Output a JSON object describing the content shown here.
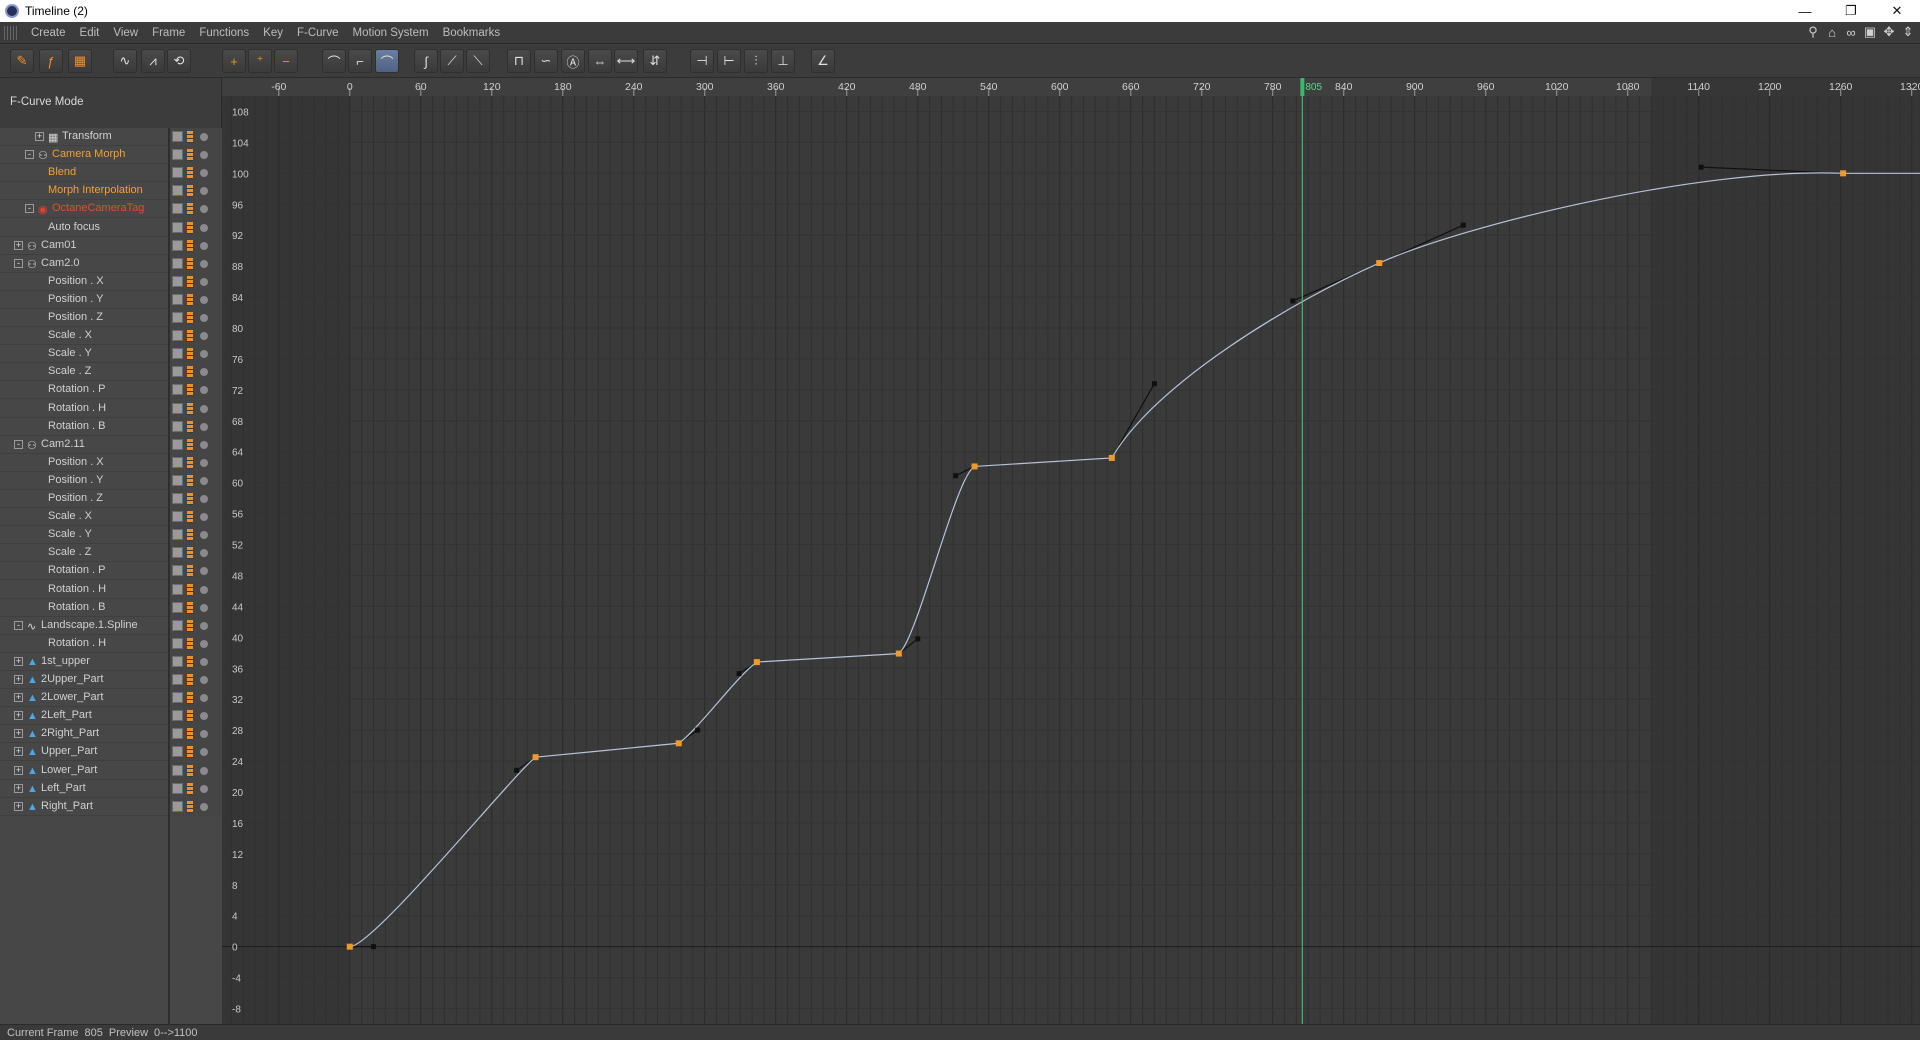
{
  "window": {
    "title": "Timeline (2)"
  },
  "menu": [
    "Create",
    "Edit",
    "View",
    "Frame",
    "Functions",
    "Key",
    "F-Curve",
    "Motion System",
    "Bookmarks"
  ],
  "toolbar_icons": [
    "key-mode-icon",
    "fcurve-mode-icon",
    "dope-sheet-icon",
    "show-curves-icon",
    "snap-curve-icon",
    "loop-icon",
    "add-key-icon",
    "add-key-multi-icon",
    "delete-key-icon",
    "tangent-zero-icon",
    "tangent-flat-icon",
    "tangent-active-icon",
    "spline-linear-icon",
    "spline-ease-in-icon",
    "spline-ease-out-icon",
    "interp-step-icon",
    "interp-curve-icon",
    "interp-auto-icon",
    "clamp-icon",
    "lock-time-icon",
    "lock-value-icon",
    "lock-tangent-icon",
    "lock-length-icon",
    "break-tangent-icon",
    "zero-angle-icon",
    "zero-length-icon"
  ],
  "sidebar": {
    "mode_label": "F-Curve Mode",
    "rows": [
      {
        "label": "Transform",
        "indent": 2,
        "toggle": "+",
        "icon": "checker-icon",
        "color": "normal"
      },
      {
        "label": "Camera Morph",
        "indent": 1,
        "toggle": "−",
        "icon": "camera-morph-icon",
        "color": "orange"
      },
      {
        "label": "Blend",
        "indent": 3,
        "toggle": "",
        "icon": "",
        "color": "orange"
      },
      {
        "label": "Morph Interpolation",
        "indent": 3,
        "toggle": "",
        "icon": "",
        "color": "orange"
      },
      {
        "label": "OctaneCameraTag",
        "indent": 1,
        "toggle": "−",
        "icon": "octane-tag-icon",
        "color": "red"
      },
      {
        "label": "Auto focus",
        "indent": 3,
        "toggle": "",
        "icon": "",
        "color": "normal"
      },
      {
        "label": "Cam01",
        "indent": 0,
        "toggle": "+",
        "icon": "camera-icon",
        "color": "normal"
      },
      {
        "label": "Cam2.0",
        "indent": 0,
        "toggle": "−",
        "icon": "camera-icon",
        "color": "normal"
      },
      {
        "label": "Position . X",
        "indent": 3,
        "toggle": "",
        "icon": "",
        "color": "normal"
      },
      {
        "label": "Position . Y",
        "indent": 3,
        "toggle": "",
        "icon": "",
        "color": "normal"
      },
      {
        "label": "Position . Z",
        "indent": 3,
        "toggle": "",
        "icon": "",
        "color": "normal"
      },
      {
        "label": "Scale . X",
        "indent": 3,
        "toggle": "",
        "icon": "",
        "color": "normal"
      },
      {
        "label": "Scale . Y",
        "indent": 3,
        "toggle": "",
        "icon": "",
        "color": "normal"
      },
      {
        "label": "Scale . Z",
        "indent": 3,
        "toggle": "",
        "icon": "",
        "color": "normal"
      },
      {
        "label": "Rotation . P",
        "indent": 3,
        "toggle": "",
        "icon": "",
        "color": "normal"
      },
      {
        "label": "Rotation . H",
        "indent": 3,
        "toggle": "",
        "icon": "",
        "color": "normal"
      },
      {
        "label": "Rotation . B",
        "indent": 3,
        "toggle": "",
        "icon": "",
        "color": "normal"
      },
      {
        "label": "Cam2.11",
        "indent": 0,
        "toggle": "−",
        "icon": "camera-icon",
        "color": "normal"
      },
      {
        "label": "Position . X",
        "indent": 3,
        "toggle": "",
        "icon": "",
        "color": "normal"
      },
      {
        "label": "Position . Y",
        "indent": 3,
        "toggle": "",
        "icon": "",
        "color": "normal"
      },
      {
        "label": "Position . Z",
        "indent": 3,
        "toggle": "",
        "icon": "",
        "color": "normal"
      },
      {
        "label": "Scale . X",
        "indent": 3,
        "toggle": "",
        "icon": "",
        "color": "normal"
      },
      {
        "label": "Scale . Y",
        "indent": 3,
        "toggle": "",
        "icon": "",
        "color": "normal"
      },
      {
        "label": "Scale . Z",
        "indent": 3,
        "toggle": "",
        "icon": "",
        "color": "normal"
      },
      {
        "label": "Rotation . P",
        "indent": 3,
        "toggle": "",
        "icon": "",
        "color": "normal"
      },
      {
        "label": "Rotation . H",
        "indent": 3,
        "toggle": "",
        "icon": "",
        "color": "normal"
      },
      {
        "label": "Rotation . B",
        "indent": 3,
        "toggle": "",
        "icon": "",
        "color": "normal"
      },
      {
        "label": "Landscape.1.Spline",
        "indent": 0,
        "toggle": "−",
        "icon": "spline-icon",
        "color": "normal"
      },
      {
        "label": "Rotation . H",
        "indent": 3,
        "toggle": "",
        "icon": "",
        "color": "normal"
      },
      {
        "label": "1st_upper",
        "indent": 0,
        "toggle": "+",
        "icon": "object-icon",
        "color": "normal"
      },
      {
        "label": "2Upper_Part",
        "indent": 0,
        "toggle": "+",
        "icon": "object-icon",
        "color": "normal"
      },
      {
        "label": "2Lower_Part",
        "indent": 0,
        "toggle": "+",
        "icon": "object-icon",
        "color": "normal"
      },
      {
        "label": "2Left_Part",
        "indent": 0,
        "toggle": "+",
        "icon": "object-icon",
        "color": "normal"
      },
      {
        "label": "2Right_Part",
        "indent": 0,
        "toggle": "+",
        "icon": "object-icon",
        "color": "normal"
      },
      {
        "label": "Upper_Part",
        "indent": 0,
        "toggle": "+",
        "icon": "object-icon",
        "color": "normal"
      },
      {
        "label": "Lower_Part",
        "indent": 0,
        "toggle": "+",
        "icon": "object-icon",
        "color": "normal"
      },
      {
        "label": "Left_Part",
        "indent": 0,
        "toggle": "+",
        "icon": "object-icon",
        "color": "normal"
      },
      {
        "label": "Right_Part",
        "indent": 0,
        "toggle": "+",
        "icon": "object-icon",
        "color": "normal"
      }
    ]
  },
  "ruler": {
    "ticks": [
      "-60",
      "0",
      "60",
      "120",
      "180",
      "240",
      "300",
      "360",
      "420",
      "480",
      "540",
      "600",
      "660",
      "720",
      "780",
      "840",
      "900",
      "960",
      "1020",
      "1080",
      "1140",
      "1200",
      "1260",
      "1320"
    ],
    "tick_values": [
      -60,
      0,
      60,
      120,
      180,
      240,
      300,
      360,
      420,
      480,
      540,
      600,
      660,
      720,
      780,
      840,
      900,
      960,
      1020,
      1080,
      1140,
      1200,
      1260,
      1320
    ],
    "current_frame_label": "805"
  },
  "chart_data": {
    "type": "line",
    "x_range": [
      -108,
      1327
    ],
    "y_range": [
      -10,
      110
    ],
    "y_ticks": [
      "108",
      "104",
      "100",
      "96",
      "92",
      "88",
      "84",
      "80",
      "76",
      "72",
      "68",
      "64",
      "60",
      "56",
      "52",
      "48",
      "44",
      "40",
      "36",
      "32",
      "28",
      "24",
      "20",
      "16",
      "12",
      "8",
      "4",
      "0",
      "-4",
      "-8"
    ],
    "y_tick_values": [
      108,
      104,
      100,
      96,
      92,
      88,
      84,
      80,
      76,
      72,
      68,
      64,
      60,
      56,
      52,
      48,
      44,
      40,
      36,
      32,
      28,
      24,
      20,
      16,
      12,
      8,
      4,
      0,
      -4,
      -8
    ],
    "preview_range": [
      0,
      1100
    ],
    "current_frame": 805,
    "keys": [
      {
        "x": 0,
        "y": 0
      },
      {
        "x": 157,
        "y": 24.5
      },
      {
        "x": 278,
        "y": 26.3
      },
      {
        "x": 344,
        "y": 36.8
      },
      {
        "x": 464,
        "y": 37.9
      },
      {
        "x": 528,
        "y": 62.1
      },
      {
        "x": 644,
        "y": 63.2
      },
      {
        "x": 870,
        "y": 88.4
      },
      {
        "x": 1262,
        "y": 100
      }
    ],
    "tangent_handles": [
      {
        "x": 20,
        "y": 0
      },
      {
        "x": 141,
        "y": 22.8
      },
      {
        "x": 294,
        "y": 28
      },
      {
        "x": 329,
        "y": 35.3
      },
      {
        "x": 480,
        "y": 39.8
      },
      {
        "x": 512,
        "y": 60.9
      },
      {
        "x": 680,
        "y": 72.8
      },
      {
        "x": 797,
        "y": 83.5
      },
      {
        "x": 941,
        "y": 93.3
      },
      {
        "x": 1142,
        "y": 100.8
      }
    ],
    "colors": {
      "curve": "#b8c2d8",
      "key": "#f09a28",
      "handle": "#101010",
      "playhead": "#3bb86a"
    }
  },
  "status": {
    "current_frame_label": "Current Frame",
    "current_frame_value": "805",
    "preview_label": "Preview",
    "preview_value": "0-->1100"
  }
}
